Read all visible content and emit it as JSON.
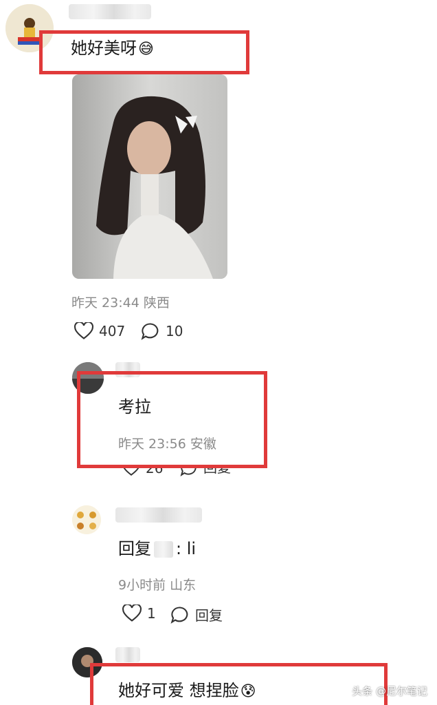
{
  "comments": [
    {
      "text": "她好美呀",
      "emoji": "😅",
      "meta": "昨天 23:44 陕西",
      "likes": "407",
      "replies": "10"
    },
    {
      "text": "考拉",
      "meta": "昨天 23:56 安徽",
      "likes": "26",
      "reply_label": "回复"
    },
    {
      "text_prefix": "回复",
      "text_suffix": ": li",
      "meta": "9小时前 山东",
      "likes": "1",
      "reply_label": "回复"
    },
    {
      "text": "她好可爱 想捏脸",
      "emoji": "😰"
    }
  ],
  "watermark": "头条 @尼尔笔记",
  "colors": {
    "highlight": "#e03a3a",
    "meta_text": "#8a8a8a",
    "background": "#ffffff"
  }
}
